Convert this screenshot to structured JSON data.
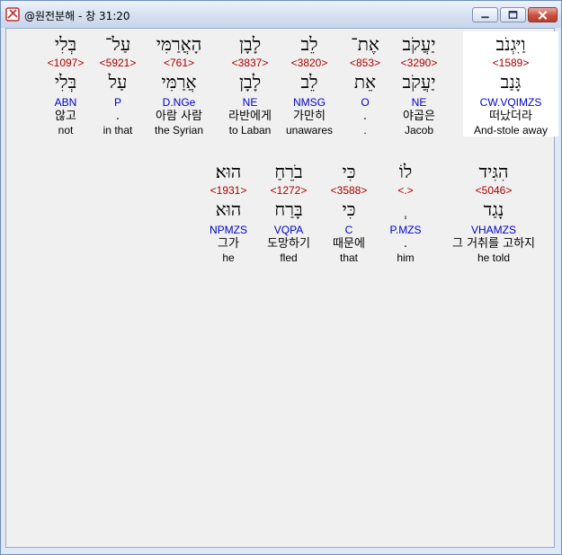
{
  "window": {
    "title": "@원전분해 - 창 31:20",
    "icon": "app-icon"
  },
  "rows": [
    [
      {
        "hebrew": "וַיִּגְנֹב",
        "strong": "<1589>",
        "lemma": "גָּנַב",
        "parse": "CW.VQIMZS",
        "korean": "떠났더라",
        "english": "And-stole away",
        "highlight": true
      },
      {
        "hebrew": "יַעֲקֹב",
        "strong": "<3290>",
        "lemma": "יַעֲקֹב",
        "parse": "NE",
        "korean": "야곱은",
        "english": "Jacob"
      },
      {
        "hebrew": "אֶת־",
        "strong": "<853>",
        "lemma": "אֵת",
        "parse": "O",
        "korean": ".",
        "english": "."
      },
      {
        "hebrew": "לֵב",
        "strong": "<3820>",
        "lemma": "לֵב",
        "parse": "NMSG",
        "korean": "가만히",
        "english": "unawares"
      },
      {
        "hebrew": "לָבָן",
        "strong": "<3837>",
        "lemma": "לָבָן",
        "parse": "NE",
        "korean": "라반에게",
        "english": "to Laban"
      },
      {
        "hebrew": "הָאֲרַמִּי",
        "strong": "<761>",
        "lemma": "אֲרַמִּי",
        "parse": "D.NGe",
        "korean": "아람 사람",
        "english": "the Syrian"
      },
      {
        "hebrew": "עַל־",
        "strong": "<5921>",
        "lemma": "עַל",
        "parse": "P",
        "korean": ".",
        "english": "in that"
      },
      {
        "hebrew": "בְּלִי",
        "strong": "<1097>",
        "lemma": "בְּלִי",
        "parse": "ABN",
        "korean": "않고",
        "english": "not"
      }
    ],
    [
      {
        "hebrew": "הִגִּיד",
        "strong": "<5046>",
        "lemma": "נָגַד",
        "parse": "VHAMZS",
        "korean": "그 거취를 고하지",
        "english": "he told"
      },
      {
        "hebrew": "לוֹ",
        "strong": "<.>",
        "lemma": "ְ",
        "parse": "P.MZS",
        "korean": ".",
        "english": "him"
      },
      {
        "hebrew": "כִּי",
        "strong": "<3588>",
        "lemma": "כִּי",
        "parse": "C",
        "korean": "때문에",
        "english": "that"
      },
      {
        "hebrew": "בֹרֵחַ",
        "strong": "<1272>",
        "lemma": "בָּרַח",
        "parse": "VQPA",
        "korean": "도망하기",
        "english": "fled"
      },
      {
        "hebrew": "הוּא׃",
        "strong": "<1931>",
        "lemma": "הוּא",
        "parse": "NPMZS",
        "korean": "그가",
        "english": "he"
      }
    ]
  ]
}
